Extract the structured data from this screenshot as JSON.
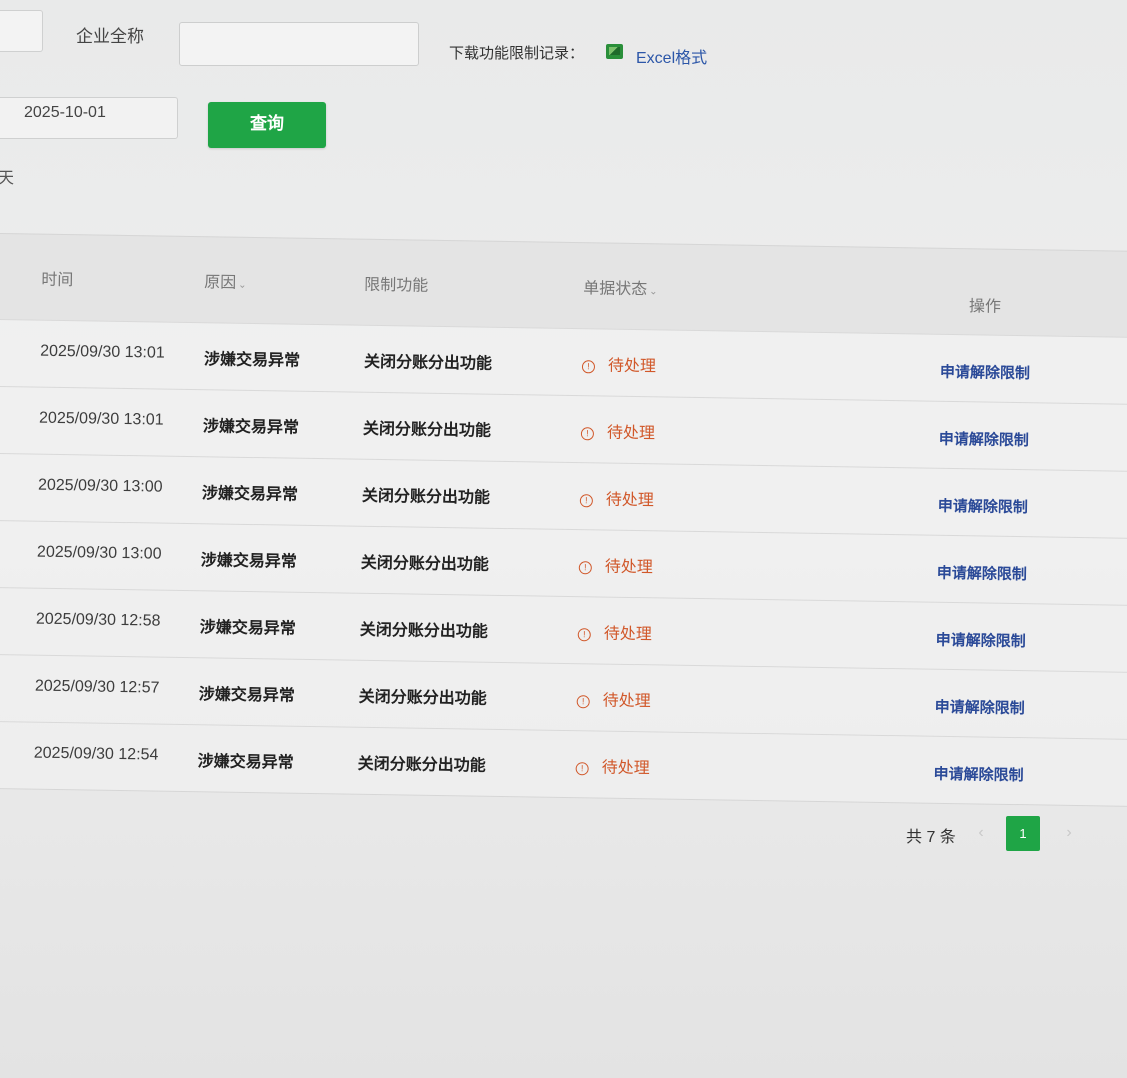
{
  "filters": {
    "company_label": "企业全称",
    "company_value": "",
    "download_label": "下载功能限制记录：",
    "excel_link": "Excel格式",
    "date_value": "2025-10-01",
    "query_button": "查询",
    "cut_text": "天"
  },
  "table": {
    "headers": {
      "time": "时间",
      "reason": "原因",
      "function": "限制功能",
      "status": "单据状态",
      "action": "操作"
    },
    "rows": [
      {
        "time": "2025/09/30 13:01",
        "reason": "涉嫌交易异常",
        "function": "关闭分账分出功能",
        "status": "待处理",
        "action": "申请解除限制"
      },
      {
        "time": "2025/09/30 13:01",
        "reason": "涉嫌交易异常",
        "function": "关闭分账分出功能",
        "status": "待处理",
        "action": "申请解除限制"
      },
      {
        "time": "2025/09/30 13:00",
        "reason": "涉嫌交易异常",
        "function": "关闭分账分出功能",
        "status": "待处理",
        "action": "申请解除限制"
      },
      {
        "time": "2025/09/30 13:00",
        "reason": "涉嫌交易异常",
        "function": "关闭分账分出功能",
        "status": "待处理",
        "action": "申请解除限制"
      },
      {
        "time": "2025/09/30 12:58",
        "reason": "涉嫌交易异常",
        "function": "关闭分账分出功能",
        "status": "待处理",
        "action": "申请解除限制"
      },
      {
        "time": "2025/09/30 12:57",
        "reason": "涉嫌交易异常",
        "function": "关闭分账分出功能",
        "status": "待处理",
        "action": "申请解除限制"
      },
      {
        "time": "2025/09/30 12:54",
        "reason": "涉嫌交易异常",
        "function": "关闭分账分出功能",
        "status": "待处理",
        "action": "申请解除限制"
      }
    ]
  },
  "pagination": {
    "total": "共 7 条",
    "current_page": "1"
  },
  "icons": {
    "status": "warning-circle-icon",
    "excel": "excel-icon",
    "sort": "chevron-down-icon"
  },
  "colors": {
    "primary": "#1fa546",
    "status_pending": "#d1582a",
    "link": "#2b4a98"
  }
}
